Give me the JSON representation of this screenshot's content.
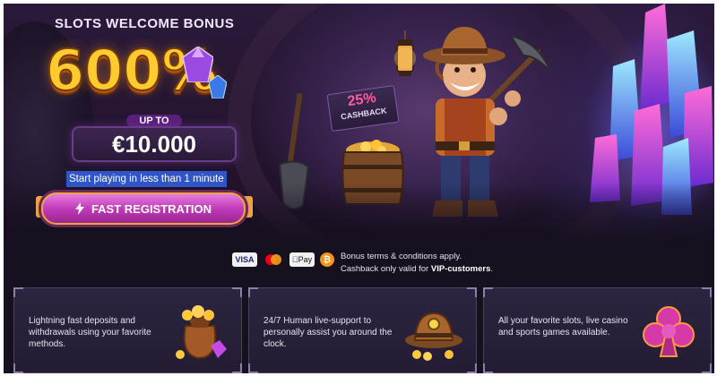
{
  "promo": {
    "headline": "SLOTS WELCOME BONUS",
    "percent": "600%",
    "up_to_label": "UP TO",
    "amount": "€10.000",
    "tagline": "Start playing in less than 1 minute",
    "cta_label": "FAST REGISTRATION"
  },
  "cashback_sign": {
    "percent": "25%",
    "label": "CASHBACK"
  },
  "payments": {
    "visa": "VISA",
    "applepay": "Pay",
    "bitcoin": "₿"
  },
  "terms": {
    "line1": "Bonus terms & conditions apply.",
    "line2_prefix": "Cashback only valid for ",
    "line2_bold": "VIP-customers",
    "line2_suffix": "."
  },
  "features": [
    {
      "text": "Lightning fast deposits and withdrawals using your favorite methods.",
      "icon": "money-bag-icon"
    },
    {
      "text": "24/7 Human live-support to personally assist you around the clock.",
      "icon": "miner-hat-icon"
    },
    {
      "text": "All your favorite slots, live casino and sports games available.",
      "icon": "club-suit-icon"
    }
  ],
  "colors": {
    "gold": "#ffcb2f",
    "cta_pink": "#c03bb9",
    "tagline_blue": "#2f55c8",
    "card_bg": "#2c2540"
  }
}
